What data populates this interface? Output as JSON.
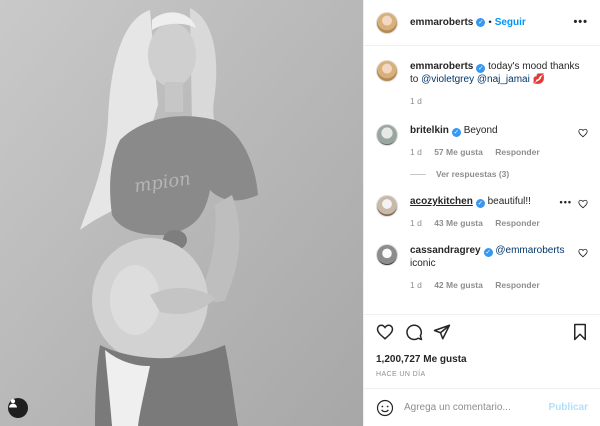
{
  "header": {
    "username": "emmaroberts",
    "follow_label": "Seguir",
    "separator": "•",
    "more": "•••"
  },
  "caption": {
    "username": "emmaroberts",
    "text": " today's mood thanks to ",
    "mention_1": "@violetgrey",
    "mention_2": "@naj_jamai",
    "emoji": "💋",
    "time": "1 d"
  },
  "comments": [
    {
      "username": "britelkin",
      "text": "Beyond",
      "time": "1 d",
      "likes": "57 Me gusta",
      "reply": "Responder",
      "view_replies": "Ver respuestas (3)"
    },
    {
      "username": "acozykitchen",
      "text": "beautiful!!",
      "time": "1 d",
      "likes": "43 Me gusta",
      "reply": "Responder",
      "more": "•••"
    },
    {
      "username": "cassandragrey",
      "mention": "@emmaroberts",
      "text": "iconic",
      "time": "1 d",
      "likes": "42 Me gusta",
      "reply": "Responder"
    }
  ],
  "footer": {
    "likes": "1,200,727 Me gusta",
    "ago": "HACE UN DÍA",
    "comment_placeholder": "Agrega un comentario...",
    "publish_label": "Publicar"
  },
  "icons": {
    "like": "heart-icon",
    "comment": "comment-icon",
    "share": "paper-plane-icon",
    "save": "bookmark-icon",
    "emoji": "smiley-icon",
    "user_tag": "user-icon"
  },
  "colors": {
    "accent": "#0095f6",
    "verified": "#3897f0",
    "muted": "#8e8e8e"
  }
}
